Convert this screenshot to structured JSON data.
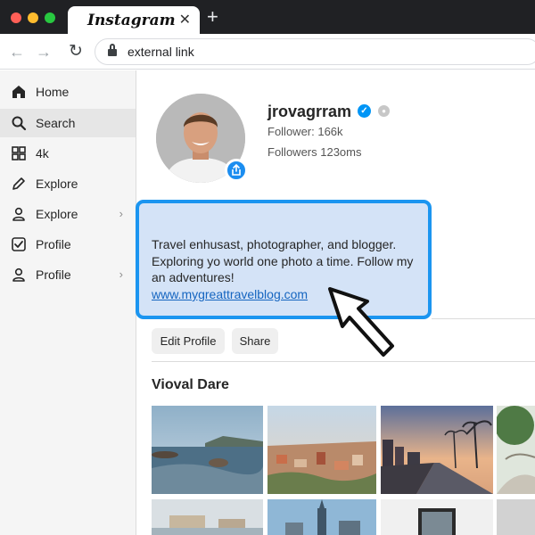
{
  "browser": {
    "tab_title": "Instagram",
    "tab_close": "✕",
    "new_tab": "+",
    "url": "external link",
    "back": "←",
    "forward": "→",
    "reload": "↻"
  },
  "sidebar": {
    "items": [
      {
        "label": "Home",
        "icon": "home-icon",
        "active": false
      },
      {
        "label": "Search",
        "icon": "search-icon",
        "active": true
      },
      {
        "label": "4k",
        "icon": "grid-icon",
        "active": false
      },
      {
        "label": "Explore",
        "icon": "pencil-icon",
        "active": false
      },
      {
        "label": "Explore",
        "icon": "person-icon",
        "active": false,
        "chevron": "›"
      },
      {
        "label": "Profile",
        "icon": "checkbox-icon",
        "active": false
      },
      {
        "label": "Profile",
        "icon": "person-icon",
        "active": false,
        "chevron": "›"
      }
    ]
  },
  "profile": {
    "username": "jrovagrram",
    "followers_line": "Follower: 166k",
    "following_line": "Followers 123oms",
    "bio_lines": [
      "Travel enhusast, photographer, and blogger.",
      "Exploring yo world one photo a time. Follow my",
      "an adventures!"
    ],
    "bio_link": "www.mygreattravelblog.com",
    "edit_button": "Edit Profile",
    "share_button": "Share",
    "section_title": "Vioval Dare"
  },
  "colors": {
    "accent": "#1b95f0",
    "highlight": "#d4e3f7",
    "link": "#1565c0",
    "verified": "#0095f6"
  }
}
